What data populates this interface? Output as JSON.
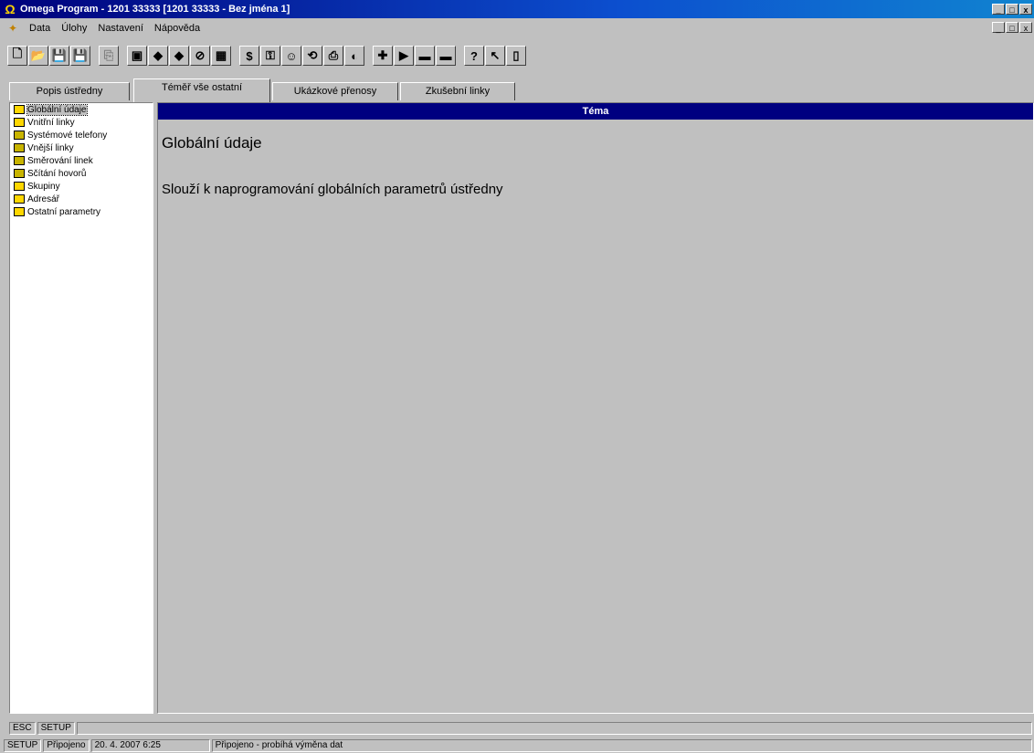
{
  "window": {
    "title": "Omega Program - 1201 33333 [1201 33333 - Bez jména 1]",
    "controls": [
      "_",
      "□",
      "x"
    ],
    "accent": "#000080"
  },
  "menu": {
    "items": [
      {
        "label": "Data",
        "icon": "menu-app-icon"
      },
      {
        "label": "Úlohy"
      },
      {
        "label": "Nastavení"
      },
      {
        "label": "Nápověda"
      }
    ],
    "mdi_controls": [
      "_",
      "□",
      "x"
    ]
  },
  "toolbar": {
    "buttons": [
      {
        "name": "new-icon",
        "glyph": "🗋"
      },
      {
        "name": "open-icon",
        "glyph": "📂"
      },
      {
        "name": "save-icon",
        "glyph": "💾"
      },
      {
        "name": "save-as-icon",
        "glyph": "💾"
      },
      {
        "name": "disabled-icon",
        "glyph": "⎘",
        "disabled": true
      },
      {
        "name": "module-icon",
        "glyph": "▣"
      },
      {
        "name": "download-icon",
        "glyph": "◆"
      },
      {
        "name": "upload-icon",
        "glyph": "◆"
      },
      {
        "name": "stop-icon",
        "glyph": "⊘"
      },
      {
        "name": "grid-icon",
        "glyph": "▦"
      },
      {
        "name": "money-icon",
        "glyph": "$"
      },
      {
        "name": "key-icon",
        "glyph": "⚿"
      },
      {
        "name": "user-icon",
        "glyph": "☺"
      },
      {
        "name": "refresh-icon",
        "glyph": "⟲"
      },
      {
        "name": "print-icon",
        "glyph": "⎙"
      },
      {
        "name": "preview-icon",
        "glyph": "◐"
      },
      {
        "name": "flag-uk-icon",
        "glyph": "✚"
      },
      {
        "name": "flag-cz-icon",
        "glyph": "▶"
      },
      {
        "name": "flag-de-icon",
        "glyph": "▬"
      },
      {
        "name": "flag-es-icon",
        "glyph": "▬"
      },
      {
        "name": "help-icon",
        "glyph": "?"
      },
      {
        "name": "context-help-icon",
        "glyph": "↖"
      },
      {
        "name": "exit-icon",
        "glyph": "▯"
      }
    ]
  },
  "tabs": [
    {
      "label": "Popis ústředny",
      "active": false
    },
    {
      "label": "Téměř vše ostatní",
      "active": true
    },
    {
      "label": "Ukázkové přenosy",
      "active": false
    },
    {
      "label": "Zkušební linky",
      "active": false
    }
  ],
  "tree": {
    "items": [
      {
        "label": "Globální údaje",
        "selected": true,
        "open": true
      },
      {
        "label": "Vnitřní linky",
        "open": true
      },
      {
        "label": "Systémové telefony",
        "open": false
      },
      {
        "label": "Vnější linky",
        "open": false
      },
      {
        "label": "Směrování linek",
        "open": false
      },
      {
        "label": "Sčítání hovorů",
        "open": false
      },
      {
        "label": "Skupiny",
        "open": true
      },
      {
        "label": "Adresář",
        "open": true
      },
      {
        "label": "Ostatní parametry",
        "open": true
      }
    ]
  },
  "content": {
    "header": "Téma",
    "title": "Globální údaje",
    "description": "Slouží k naprogramování globálních parametrů ústředny"
  },
  "status": {
    "row1": [
      "ESC",
      "SETUP"
    ],
    "row2": [
      "SETUP",
      "Připojeno",
      "20. 4. 2007 6:25",
      "Připojeno - probíhá výměna dat"
    ]
  }
}
